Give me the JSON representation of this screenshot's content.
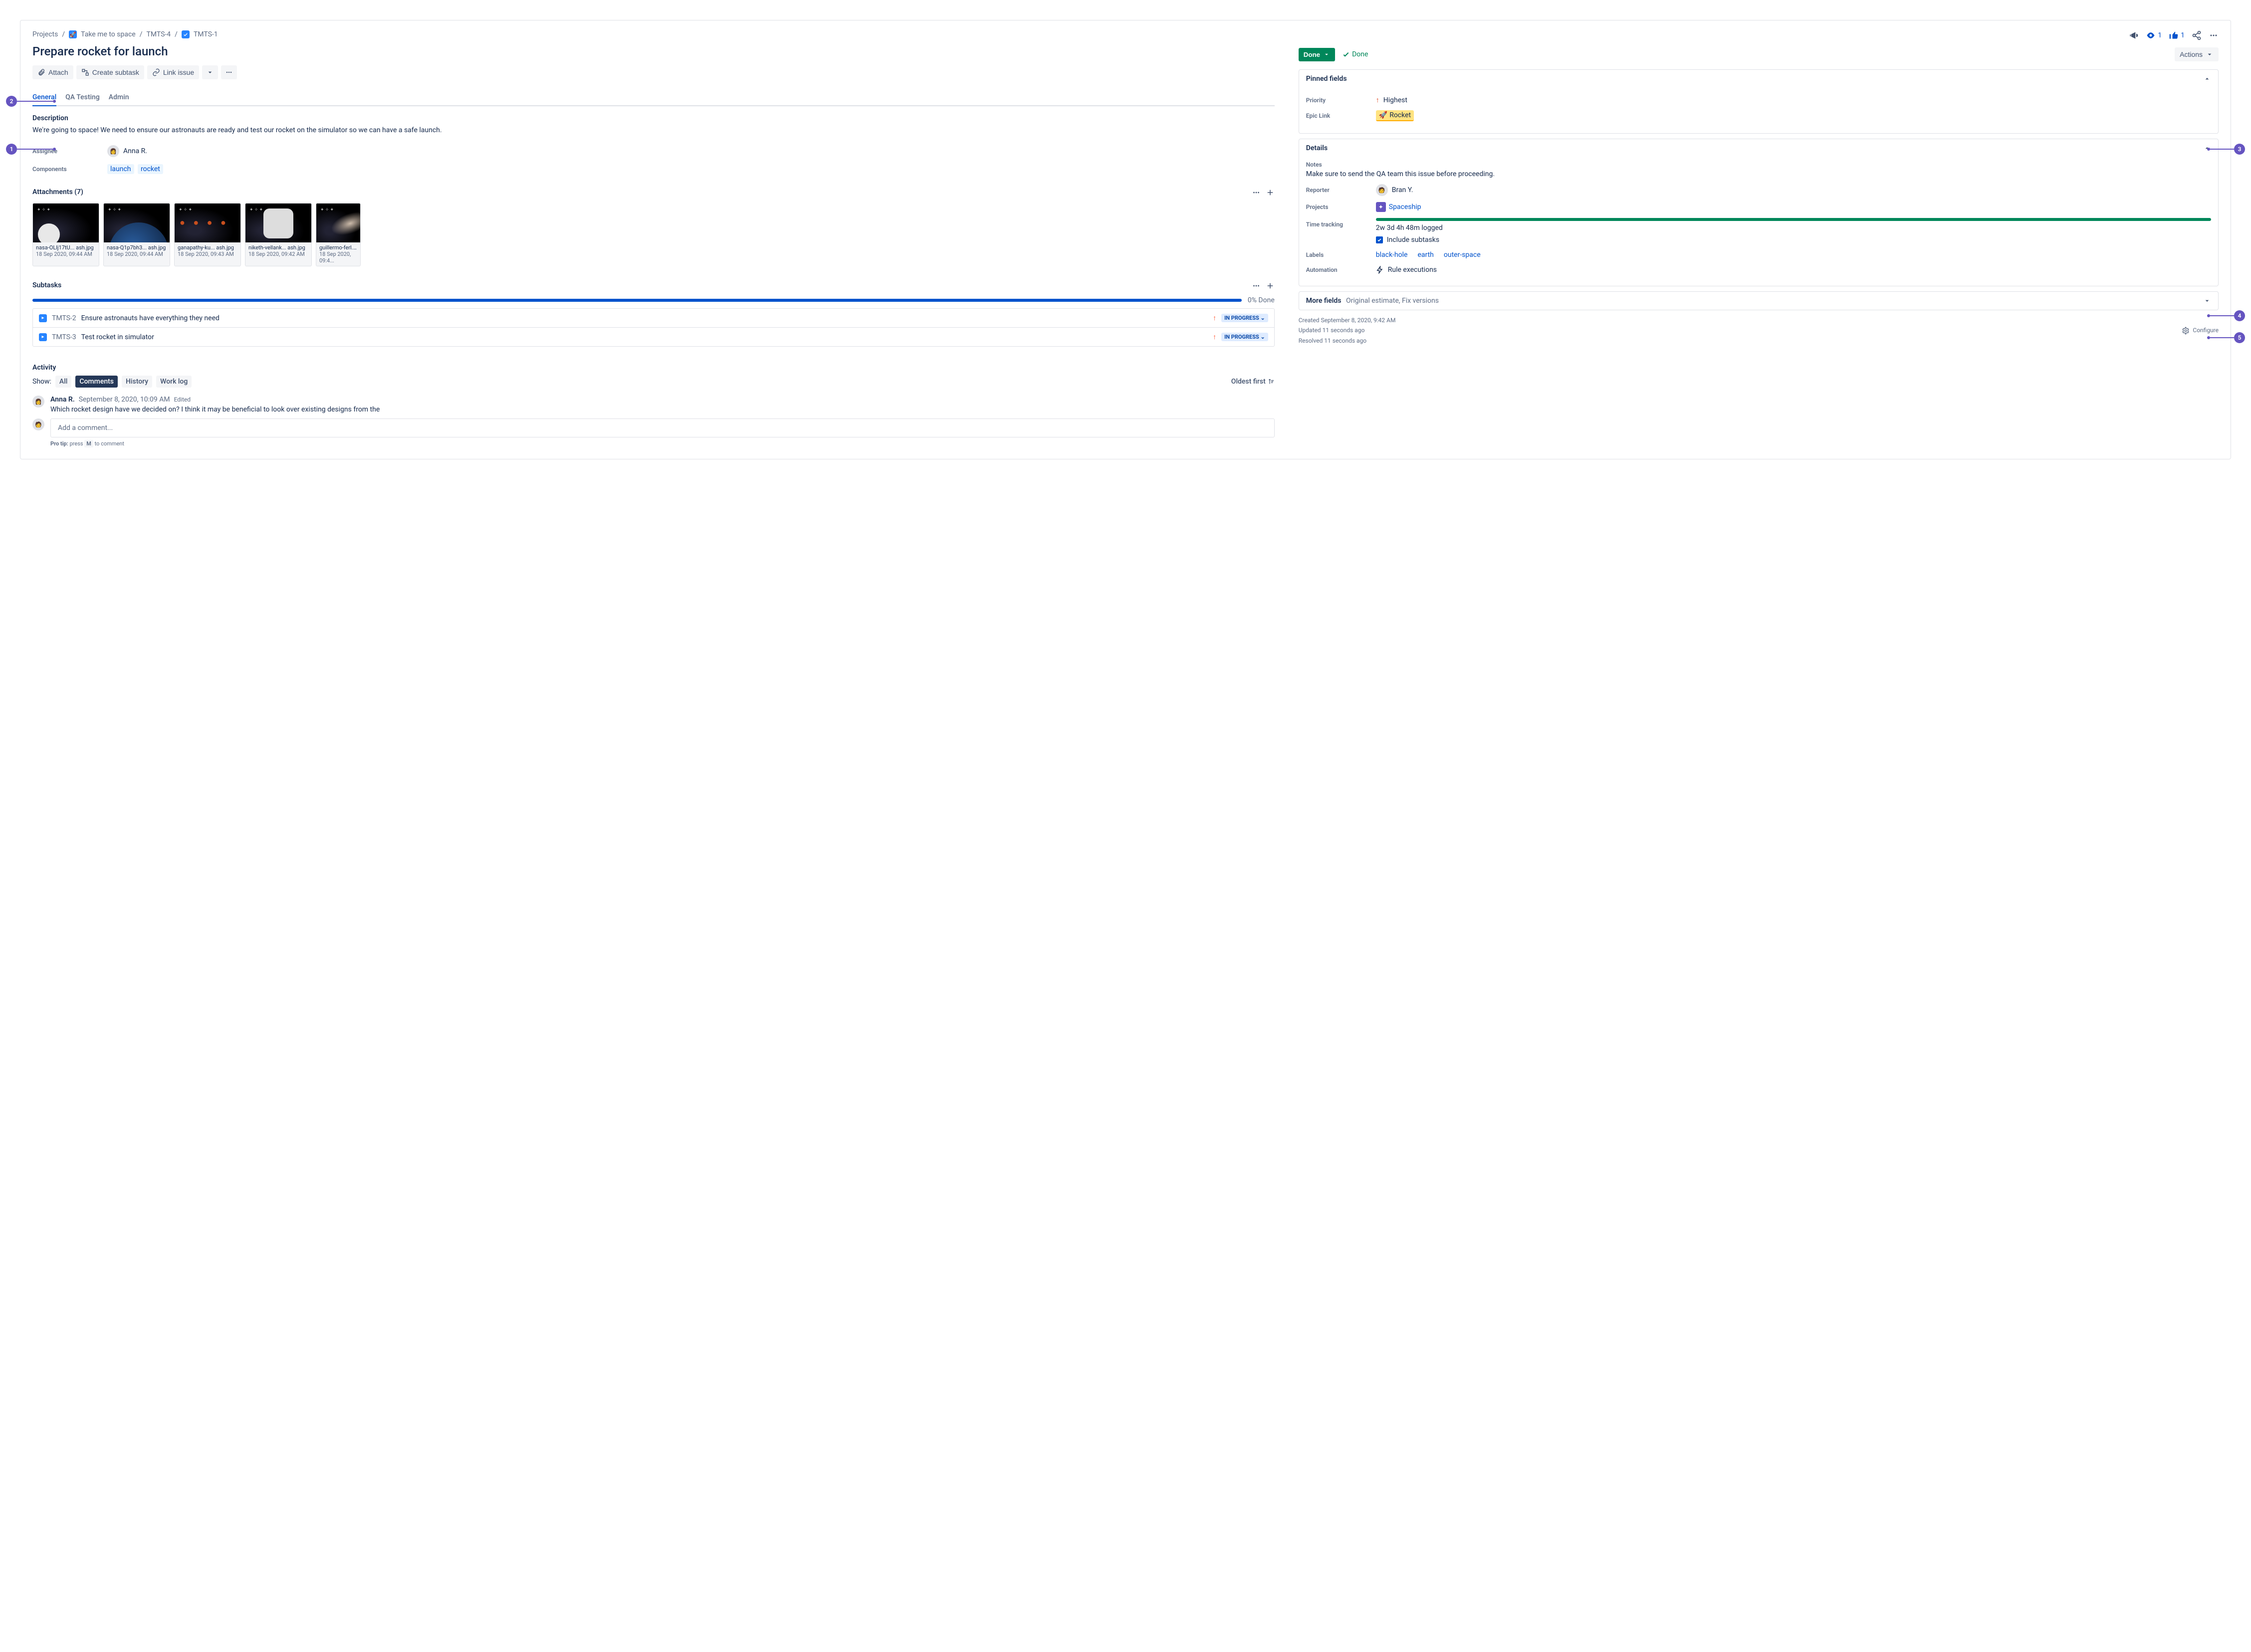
{
  "breadcrumbs": {
    "projects": "Projects",
    "project_name": "Take me to space",
    "parent_key": "TMTS-4",
    "issue_key": "TMTS-1"
  },
  "title": "Prepare rocket for launch",
  "toolbar": {
    "attach": "Attach",
    "create_subtask": "Create subtask",
    "link_issue": "Link issue"
  },
  "tabs": {
    "general": "General",
    "qa": "QA Testing",
    "admin": "Admin"
  },
  "description": {
    "heading": "Description",
    "body": "We're going to space! We need to ensure our astronauts are ready and test our rocket on the simulator so we can have a safe launch."
  },
  "left_fields": {
    "assignee_label": "Assignee",
    "assignee_name": "Anna R.",
    "components_label": "Components",
    "components": {
      "c0": "launch",
      "c1": "rocket"
    }
  },
  "attachments": {
    "heading": "Attachments (7)",
    "items": [
      {
        "fn": "nasa-OLlj17tU... ash.jpg",
        "dt": "18 Sep 2020, 09:44 AM"
      },
      {
        "fn": "nasa-Q1p7bh3... ash.jpg",
        "dt": "18 Sep 2020, 09:44 AM"
      },
      {
        "fn": "ganapathy-ku... ash.jpg",
        "dt": "18 Sep 2020, 09:43 AM"
      },
      {
        "fn": "niketh-vellank... ash.jpg",
        "dt": "18 Sep 2020, 09:42 AM"
      },
      {
        "fn": "guillermo-ferl... a...",
        "dt": "18 Sep 2020, 09:4..."
      }
    ]
  },
  "subtasks": {
    "heading": "Subtasks",
    "done_pct": "0% Done",
    "rows": [
      {
        "key": "TMTS-2",
        "title": "Ensure astronauts have everything they need",
        "status": "IN PROGRESS"
      },
      {
        "key": "TMTS-3",
        "title": "Test rocket in simulator",
        "status": "IN PROGRESS"
      }
    ]
  },
  "activity": {
    "heading": "Activity",
    "show_label": "Show:",
    "filters": {
      "all": "All",
      "comments": "Comments",
      "history": "History",
      "worklog": "Work log"
    },
    "sort": "Oldest first",
    "comment": {
      "author": "Anna R.",
      "date": "September 8, 2020, 10:09 AM",
      "edited": "Edited",
      "body": "Which rocket design have we decided on? I think it may be beneficial to look over existing designs from the"
    },
    "add_placeholder": "Add a comment...",
    "pro_tip_pre": "Pro tip: ",
    "pro_tip_press": "press",
    "pro_tip_key": "M",
    "pro_tip_post": "to comment"
  },
  "right_top": {
    "watch_count": "1",
    "vote_count": "1"
  },
  "status": {
    "done_btn": "Done",
    "done_label": "Done",
    "actions": "Actions"
  },
  "pinned": {
    "heading": "Pinned fields",
    "priority_label": "Priority",
    "priority_value": "Highest",
    "epic_label": "Epic Link",
    "epic_value": "Rocket"
  },
  "details": {
    "heading": "Details",
    "notes_label": "Notes",
    "notes_value": "Make sure to send the QA team this issue before proceeding.",
    "reporter_label": "Reporter",
    "reporter_name": "Bran Y.",
    "projects_label": "Projects",
    "project_name": "Spaceship",
    "tt_label": "Time tracking",
    "tt_value": "2w 3d 4h 48m logged",
    "tt_include": "Include subtasks",
    "labels_label": "Labels",
    "labels": {
      "l0": "black-hole",
      "l1": "earth",
      "l2": "outer-space"
    },
    "automation_label": "Automation",
    "automation_value": "Rule executions"
  },
  "more_fields": {
    "heading": "More fields",
    "hint": "Original estimate, Fix versions"
  },
  "timestamps": {
    "created": "Created September 8, 2020, 9:42 AM",
    "updated": "Updated 11 seconds ago",
    "resolved": "Resolved 11 seconds ago",
    "configure": "Configure"
  },
  "callouts": {
    "n1": "1",
    "n2": "2",
    "n3": "3",
    "n4": "4",
    "n5": "5"
  }
}
